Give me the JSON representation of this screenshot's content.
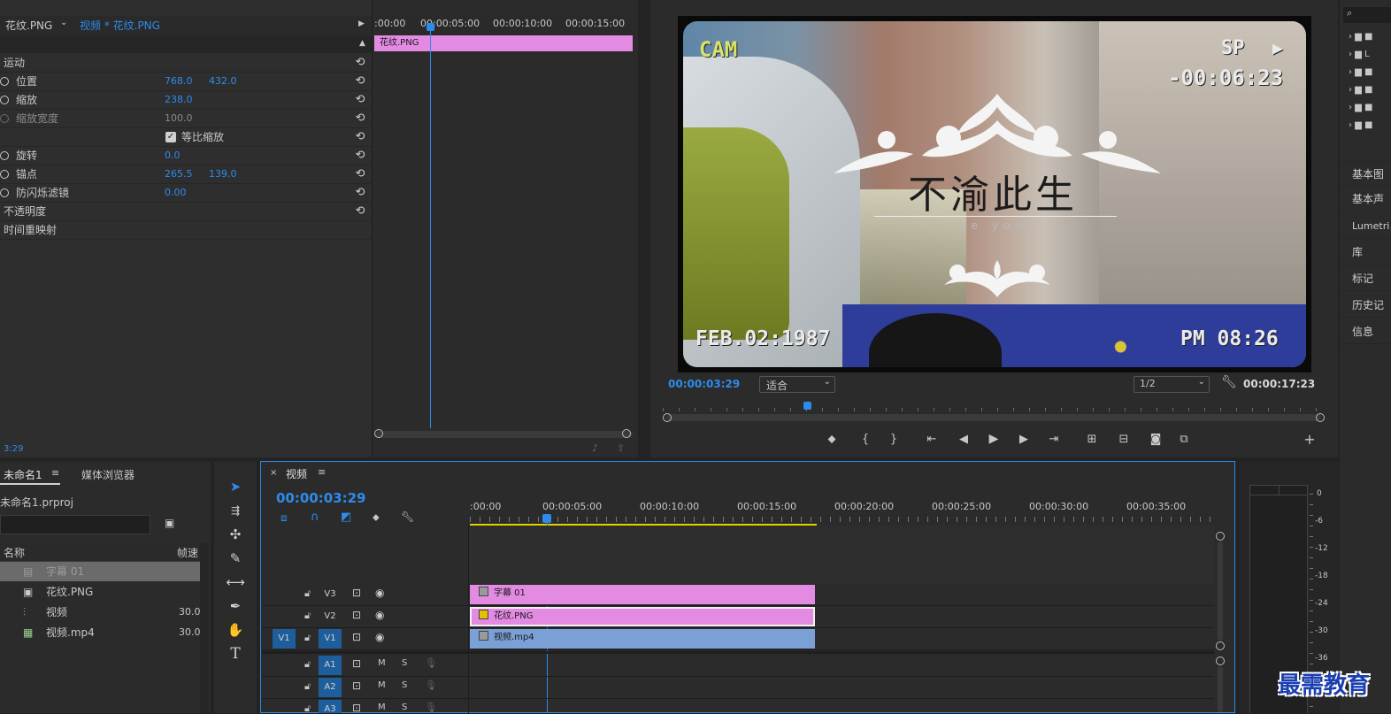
{
  "effect_controls": {
    "source_clip": "花纹.PNG",
    "sequence_clip": "视频 * 花纹.PNG",
    "section_motion": "运动",
    "position_label": "位置",
    "position_x": "768.0",
    "position_y": "432.0",
    "scale_label": "缩放",
    "scale_value": "238.0",
    "scale_width_label": "缩放宽度",
    "scale_width_value": "100.0",
    "uniform_scale_label": "等比缩放",
    "rotation_label": "旋转",
    "rotation_value": "0.0",
    "anchor_label": "锚点",
    "anchor_x": "265.5",
    "anchor_y": "139.0",
    "antiflicker_label": "防闪烁滤镜",
    "antiflicker_value": "0.00",
    "opacity_label": "不透明度",
    "time_remap_label": "时间重映射",
    "bottom_time": "3:29",
    "mini_ruler": [
      ":00:00",
      "00:00:05:00",
      "00:00:10:00",
      "00:00:15:00"
    ],
    "mini_clip": "花纹.PNG"
  },
  "program": {
    "current_time": "00:00:03:29",
    "fit_label": "适合",
    "resolution": "1/2",
    "duration": "00:00:17:23",
    "overlay": {
      "cam": "CAM",
      "sp": "SP",
      "counter": "-00:06:23",
      "date": "FEB.02:1987",
      "clock": "PM 08:26",
      "title": "不渝此生",
      "subtitle": "be your"
    }
  },
  "right_panel": {
    "search_icon": "search-icon",
    "items": [
      "基本图",
      "基本声",
      "Lumetri",
      "库",
      "标记",
      "历史记",
      "信息"
    ]
  },
  "project": {
    "tab_project": "未命名1",
    "tab_media": "媒体浏览器",
    "project_file": "未命名1.prproj",
    "col_name": "名称",
    "col_rate": "帧速",
    "items": [
      {
        "name": "字幕 01",
        "rate": ""
      },
      {
        "name": "花纹.PNG",
        "rate": ""
      },
      {
        "name": "视频",
        "rate": "30.00"
      },
      {
        "name": "视频.mp4",
        "rate": "30.00"
      }
    ]
  },
  "timeline": {
    "sequence_name": "视频",
    "timecode": "00:00:03:29",
    "ruler": [
      ":00:00",
      "00:00:05:00",
      "00:00:10:00",
      "00:00:15:00",
      "00:00:20:00",
      "00:00:25:00",
      "00:00:30:00",
      "00:00:35:00"
    ],
    "tracks": [
      {
        "label": "V3",
        "clip": "字幕 01"
      },
      {
        "label": "V2",
        "clip": "花纹.PNG"
      },
      {
        "label": "V1",
        "clip": "视频.mp4",
        "src": "V1"
      },
      {
        "label": "A1"
      },
      {
        "label": "A2"
      },
      {
        "label": "A3"
      }
    ],
    "mute_label": "M",
    "solo_label": "S"
  },
  "meter": {
    "scale": [
      "0",
      "-6",
      "-12",
      "-18",
      "-24",
      "-30",
      "-36"
    ]
  },
  "watermark": "最需教育",
  "colors": {
    "accent": "#2d8ceb",
    "clip_pink": "#e38ae3",
    "clip_blue": "#7aa0d6",
    "work_area": "#e5d000"
  }
}
